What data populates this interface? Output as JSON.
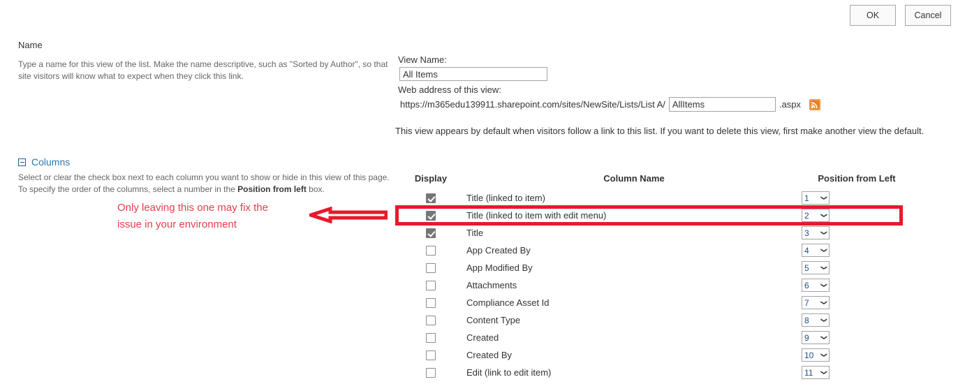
{
  "toolbar": {
    "ok_label": "OK",
    "cancel_label": "Cancel"
  },
  "name_section": {
    "heading": "Name",
    "description": "Type a name for this view of the list. Make the name descriptive, such as \"Sorted by Author\", so that site visitors will know what to expect when they click this link.",
    "view_name_label": "View Name:",
    "view_name_value": "All Items",
    "web_address_label": "Web address of this view:",
    "url_prefix": "https://m365edu139911.sharepoint.com/sites/NewSite/Lists/List A/",
    "url_value": "AllItems",
    "url_suffix": ".aspx",
    "rss_icon": "rss-feed-icon",
    "default_note": "This view appears by default when visitors follow a link to this list. If you want to delete this view, first make another view the default."
  },
  "columns_section": {
    "collapse_icon": "collapse-minus-icon",
    "heading": "Columns",
    "description_part1": "Select or clear the check box next to each column you want to show or hide in this view of this page. To specify the order of the columns, select a number in the ",
    "description_bold": "Position from left",
    "description_part2": " box.",
    "headers": {
      "display": "Display",
      "column_name": "Column Name",
      "position": "Position from Left"
    },
    "rows": [
      {
        "checked": true,
        "disabled": true,
        "name": "Title (linked to item)",
        "position": "1",
        "highlighted": false
      },
      {
        "checked": true,
        "disabled": true,
        "name": "Title (linked to item with edit menu)",
        "position": "2",
        "highlighted": true
      },
      {
        "checked": true,
        "disabled": true,
        "name": "Title",
        "position": "3",
        "highlighted": false
      },
      {
        "checked": false,
        "disabled": false,
        "name": "App Created By",
        "position": "4",
        "highlighted": false
      },
      {
        "checked": false,
        "disabled": false,
        "name": "App Modified By",
        "position": "5",
        "highlighted": false
      },
      {
        "checked": false,
        "disabled": false,
        "name": "Attachments",
        "position": "6",
        "highlighted": false
      },
      {
        "checked": false,
        "disabled": false,
        "name": "Compliance Asset Id",
        "position": "7",
        "highlighted": false
      },
      {
        "checked": false,
        "disabled": false,
        "name": "Content Type",
        "position": "8",
        "highlighted": false
      },
      {
        "checked": false,
        "disabled": false,
        "name": "Created",
        "position": "9",
        "highlighted": false
      },
      {
        "checked": false,
        "disabled": false,
        "name": "Created By",
        "position": "10",
        "highlighted": false
      },
      {
        "checked": false,
        "disabled": false,
        "name": "Edit (link to edit item)",
        "position": "11",
        "highlighted": false
      }
    ]
  },
  "annotation": {
    "text_line1": "Only leaving this one may fix the",
    "text_line2": "issue in your environment",
    "arrow_icon": "left-arrow-annotation-icon",
    "highlight_icon": "red-highlight-rectangle",
    "text_color": "#e33d4d",
    "rect_color": "#e8192c"
  }
}
